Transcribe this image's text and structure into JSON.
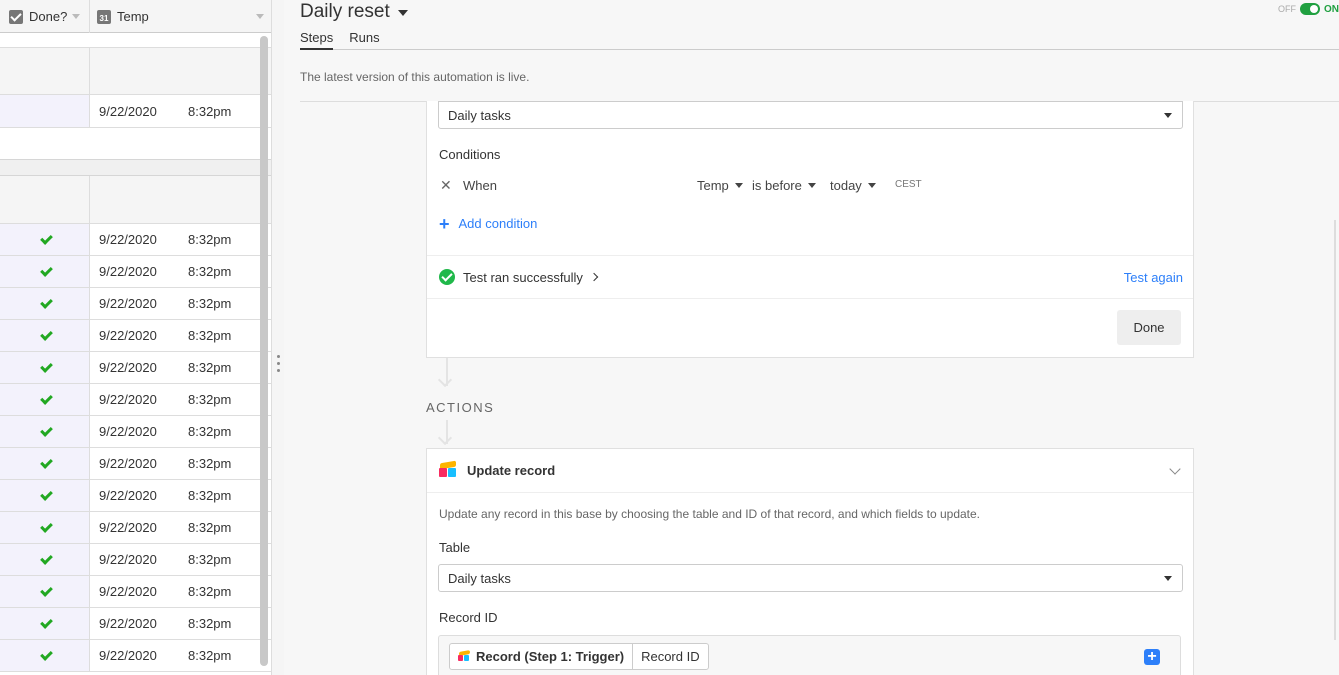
{
  "grid": {
    "columns": [
      {
        "label": "Done?",
        "icon": "checkbox-icon"
      },
      {
        "label": "Temp",
        "icon": "calendar-icon",
        "icon_text": "31"
      }
    ],
    "rows": [
      {
        "done": false,
        "date": "9/22/2020",
        "time": "8:32pm"
      },
      {
        "done": true,
        "date": "9/22/2020",
        "time": "8:32pm"
      },
      {
        "done": true,
        "date": "9/22/2020",
        "time": "8:32pm"
      },
      {
        "done": true,
        "date": "9/22/2020",
        "time": "8:32pm"
      },
      {
        "done": true,
        "date": "9/22/2020",
        "time": "8:32pm"
      },
      {
        "done": true,
        "date": "9/22/2020",
        "time": "8:32pm"
      },
      {
        "done": true,
        "date": "9/22/2020",
        "time": "8:32pm"
      },
      {
        "done": true,
        "date": "9/22/2020",
        "time": "8:32pm"
      },
      {
        "done": true,
        "date": "9/22/2020",
        "time": "8:32pm"
      },
      {
        "done": true,
        "date": "9/22/2020",
        "time": "8:32pm"
      },
      {
        "done": true,
        "date": "9/22/2020",
        "time": "8:32pm"
      },
      {
        "done": true,
        "date": "9/22/2020",
        "time": "8:32pm"
      },
      {
        "done": true,
        "date": "9/22/2020",
        "time": "8:32pm"
      },
      {
        "done": true,
        "date": "9/22/2020",
        "time": "8:32pm"
      },
      {
        "done": true,
        "date": "9/22/2020",
        "time": "8:32pm"
      }
    ]
  },
  "automation": {
    "title": "Daily reset",
    "tabs": [
      "Steps",
      "Runs"
    ],
    "active_tab": "Steps",
    "toggle": {
      "off_label": "OFF",
      "on_label": "ON",
      "state": "on"
    },
    "status_message": "The latest version of this automation is live."
  },
  "trigger": {
    "table_value": "Daily tasks",
    "conditions_label": "Conditions",
    "condition": {
      "prefix": "When",
      "field": "Temp",
      "operator": "is before",
      "value": "today",
      "timezone": "CEST"
    },
    "add_condition_label": "Add condition",
    "test_status": "Test ran successfully",
    "test_again_label": "Test again",
    "done_label": "Done"
  },
  "actions": {
    "section_label": "ACTIONS",
    "action": {
      "title": "Update record",
      "description": "Update any record in this base by choosing the table and ID of that record, and which fields to update.",
      "table_label": "Table",
      "table_value": "Daily tasks",
      "record_id_label": "Record ID",
      "token_source": "Record (Step 1: Trigger)",
      "token_field": "Record ID"
    }
  },
  "colors": {
    "accent_blue": "#2d7ff9",
    "success_green": "#20b84a",
    "toggle_green": "#20a040",
    "checkmark_green": "#22a822"
  }
}
